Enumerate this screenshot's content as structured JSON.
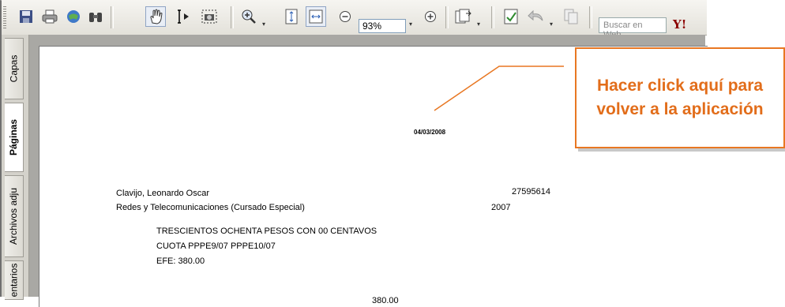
{
  "toolbar": {
    "zoom_value": "93%",
    "search_placeholder": "Buscar en Web",
    "yahoo_label": "Y!",
    "icons": [
      "save-icon",
      "print-icon",
      "email-icon",
      "find-icon",
      "hand-tool-icon",
      "select-text-icon",
      "snapshot-icon",
      "zoom-in-tool-icon",
      "fit-page-icon",
      "fit-width-icon",
      "zoom-out-icon",
      "zoom-in-icon",
      "pages-icon",
      "spellcheck-icon",
      "undo-icon",
      "copy-icon"
    ]
  },
  "sidebar": {
    "tabs": [
      {
        "label": "Capas"
      },
      {
        "label": "Páginas",
        "active": true
      },
      {
        "label": "Archivos adju"
      },
      {
        "label": "entarios"
      }
    ]
  },
  "document": {
    "date": "04/03/2008",
    "name": "Clavijo, Leonardo Oscar",
    "id_number": "27595614",
    "program": "Redes y Telecomunicaciones (Cursado Especial)",
    "year": "2007",
    "amount_words": "TRESCIENTOS OCHENTA  PESOS  CON 00 CENTAVOS",
    "cuota": "CUOTA  PPPE9/07   PPPE10/07",
    "efe": "EFE: 380.00",
    "total": "380.00"
  },
  "callout": {
    "text": "Hacer click aquí para volver a la aplicación",
    "color": "#e26d1a"
  }
}
